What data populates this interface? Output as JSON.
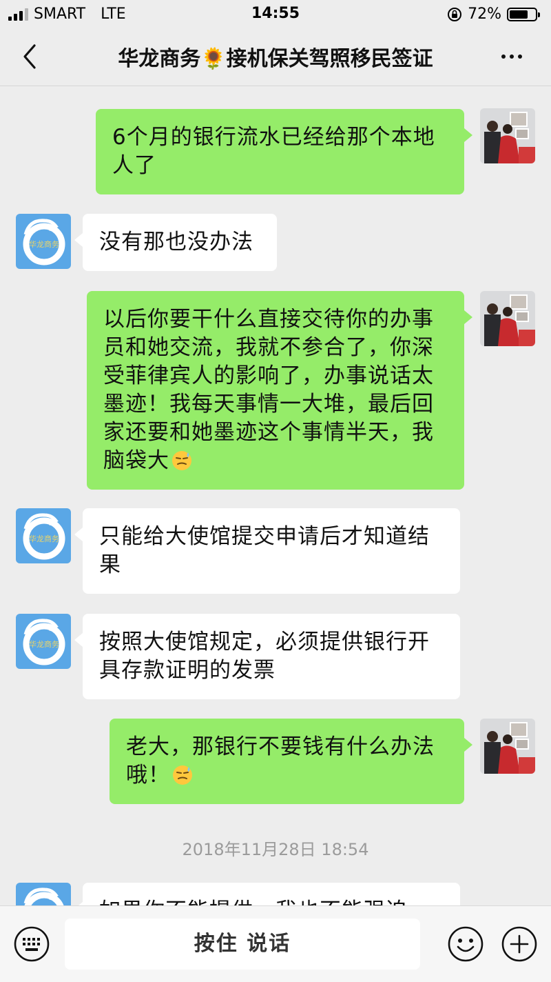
{
  "status_bar": {
    "carrier": "SMART",
    "network": "LTE",
    "time": "14:55",
    "battery": "72%",
    "battery_level": 0.72
  },
  "header": {
    "title": "华龙商务🌻接机保关驾照移民签证"
  },
  "messages": [
    {
      "side": "me",
      "text": "6个月的银行流水已经给那个本地人了"
    },
    {
      "side": "them",
      "text": "没有那也没办法"
    },
    {
      "side": "me",
      "text": "以后你要干什么直接交待你的办事员和她交流，我就不参合了，你深受菲律宾人的影响了，办事说话太墨迹！我每天事情一大堆，最后回家还要和她墨迹这个事情半天，我脑袋大",
      "emoji": "sweat-face"
    },
    {
      "side": "them",
      "text": "只能给大使馆提交申请后才知道结果"
    },
    {
      "side": "them",
      "text": "按照大使馆规定，必须提供银行开具存款证明的发票"
    },
    {
      "side": "me",
      "text": "老大，那银行不要钱有什么办法哦！",
      "emoji": "sweat-face"
    },
    {
      "side": "them",
      "text": "如果你不能提供，我也不能强迫"
    }
  ],
  "timestamp": "2018年11月28日 18:54",
  "contact_avatar": {
    "icon": "dragon-ring-logo",
    "text": "华龙商务"
  },
  "input_bar": {
    "hold_to_talk": "按住 说话"
  },
  "colors": {
    "me_bubble": "#95ec69",
    "them_bubble": "#ffffff",
    "background": "#ededed",
    "avatar_blue": "#5aa7e6"
  }
}
